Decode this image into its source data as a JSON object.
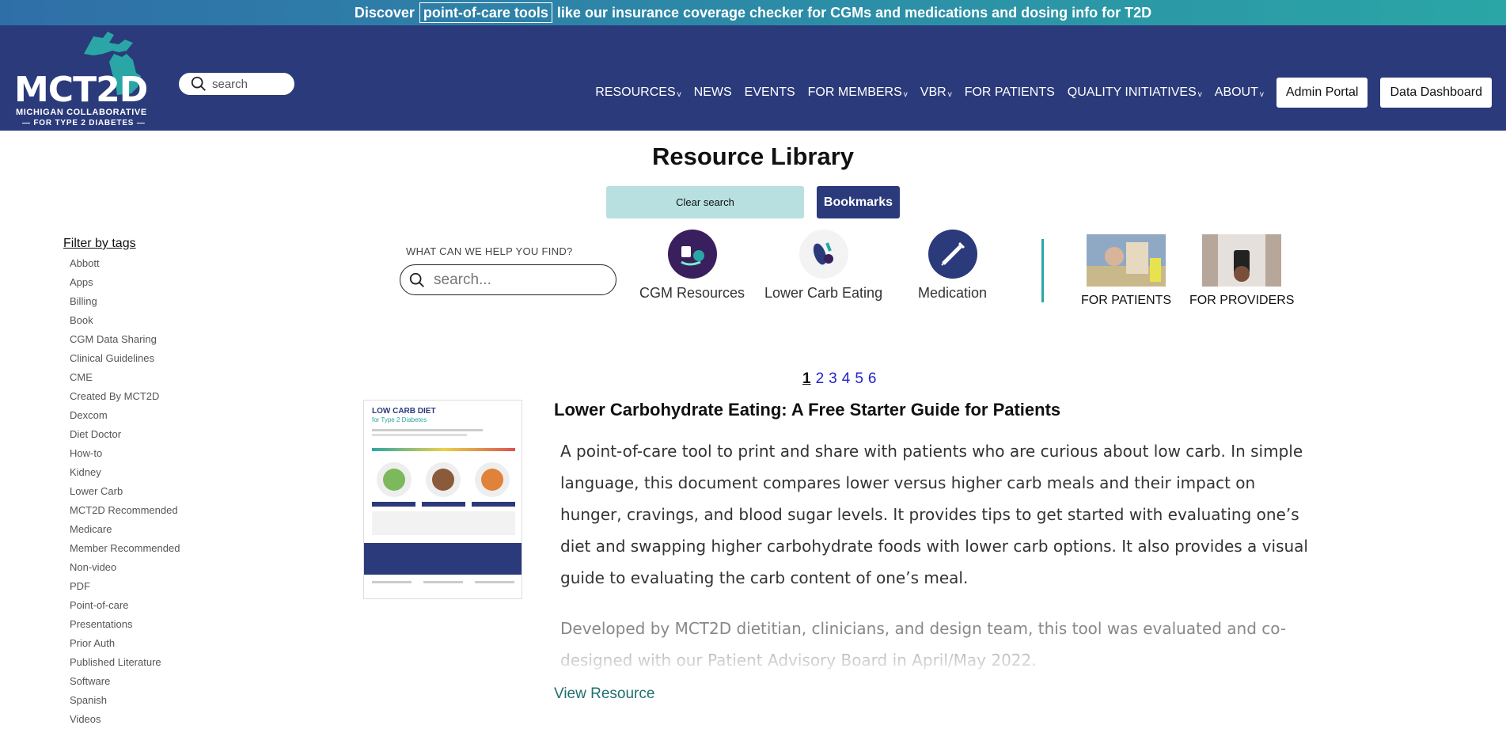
{
  "announcement": {
    "pre": "Discover",
    "link": "point-of-care tools",
    "post": "like our insurance coverage checker for CGMs and medications and dosing info for T2D"
  },
  "logo": {
    "brand": "MCT2D",
    "line1": "MICHIGAN COLLABORATIVE",
    "line2": "— FOR TYPE 2 DIABETES —"
  },
  "header_search": {
    "placeholder": "search"
  },
  "nav": {
    "items": [
      {
        "label": "RESOURCES",
        "dropdown": true
      },
      {
        "label": "NEWS",
        "dropdown": false
      },
      {
        "label": "EVENTS",
        "dropdown": false
      },
      {
        "label": "FOR MEMBERS",
        "dropdown": true
      },
      {
        "label": "VBR",
        "dropdown": true
      },
      {
        "label": "FOR PATIENTS",
        "dropdown": false
      },
      {
        "label": "QUALITY INITIATIVES",
        "dropdown": true
      },
      {
        "label": "ABOUT",
        "dropdown": true
      }
    ],
    "admin_portal": "Admin Portal",
    "data_dashboard": "Data Dashboard",
    "chevron": "v"
  },
  "page_title": "Resource Library",
  "clear_search": "Clear search",
  "bookmarks": "Bookmarks",
  "filter": {
    "title": "Filter by tags",
    "tags": [
      "Abbott",
      "Apps",
      "Billing",
      "Book",
      "CGM Data Sharing",
      "Clinical Guidelines",
      "CME",
      "Created By MCT2D",
      "Dexcom",
      "Diet Doctor",
      "How-to",
      "Kidney",
      "Lower Carb",
      "MCT2D Recommended",
      "Medicare",
      "Member Recommended",
      "Non-video",
      "PDF",
      "Point-of-care",
      "Presentations",
      "Prior Auth",
      "Published Literature",
      "Software",
      "Spanish",
      "Videos"
    ]
  },
  "help_label": "WHAT CAN WE HELP YOU FIND?",
  "main_search": {
    "placeholder": "search..."
  },
  "categories": [
    {
      "label": "CGM Resources",
      "icon": "cgm-icon"
    },
    {
      "label": "Lower Carb Eating",
      "icon": "lower-carb-icon"
    },
    {
      "label": "Medication",
      "icon": "syringe-icon"
    }
  ],
  "audiences": [
    {
      "label": "FOR PATIENTS"
    },
    {
      "label": "FOR PROVIDERS"
    }
  ],
  "pagination": {
    "pages": [
      "1",
      "2",
      "3",
      "4",
      "5",
      "6"
    ],
    "current": "1"
  },
  "resource": {
    "title": "Lower Carbohydrate Eating: A Free Starter Guide for Patients",
    "body": "A point-of-care tool to print and share with patients who are curious about low carb. In simple language, this document compares lower versus higher carb meals and their impact on hunger, cravings, and blood sugar levels. It provides tips to get started with evaluating one’s diet and swapping higher carbohydrate foods with lower carb options. It also provides a visual guide to evaluating the carb content of one’s meal.",
    "body2": "Developed by MCT2D dietitian, clinicians, and design team, this tool was evaluated and co-designed with our Patient Advisory Board in April/May 2022.",
    "view_link": "View Resource",
    "thumb_title": "LOW CARB DIET",
    "thumb_subtitle": "for Type 2 Diabetes"
  }
}
